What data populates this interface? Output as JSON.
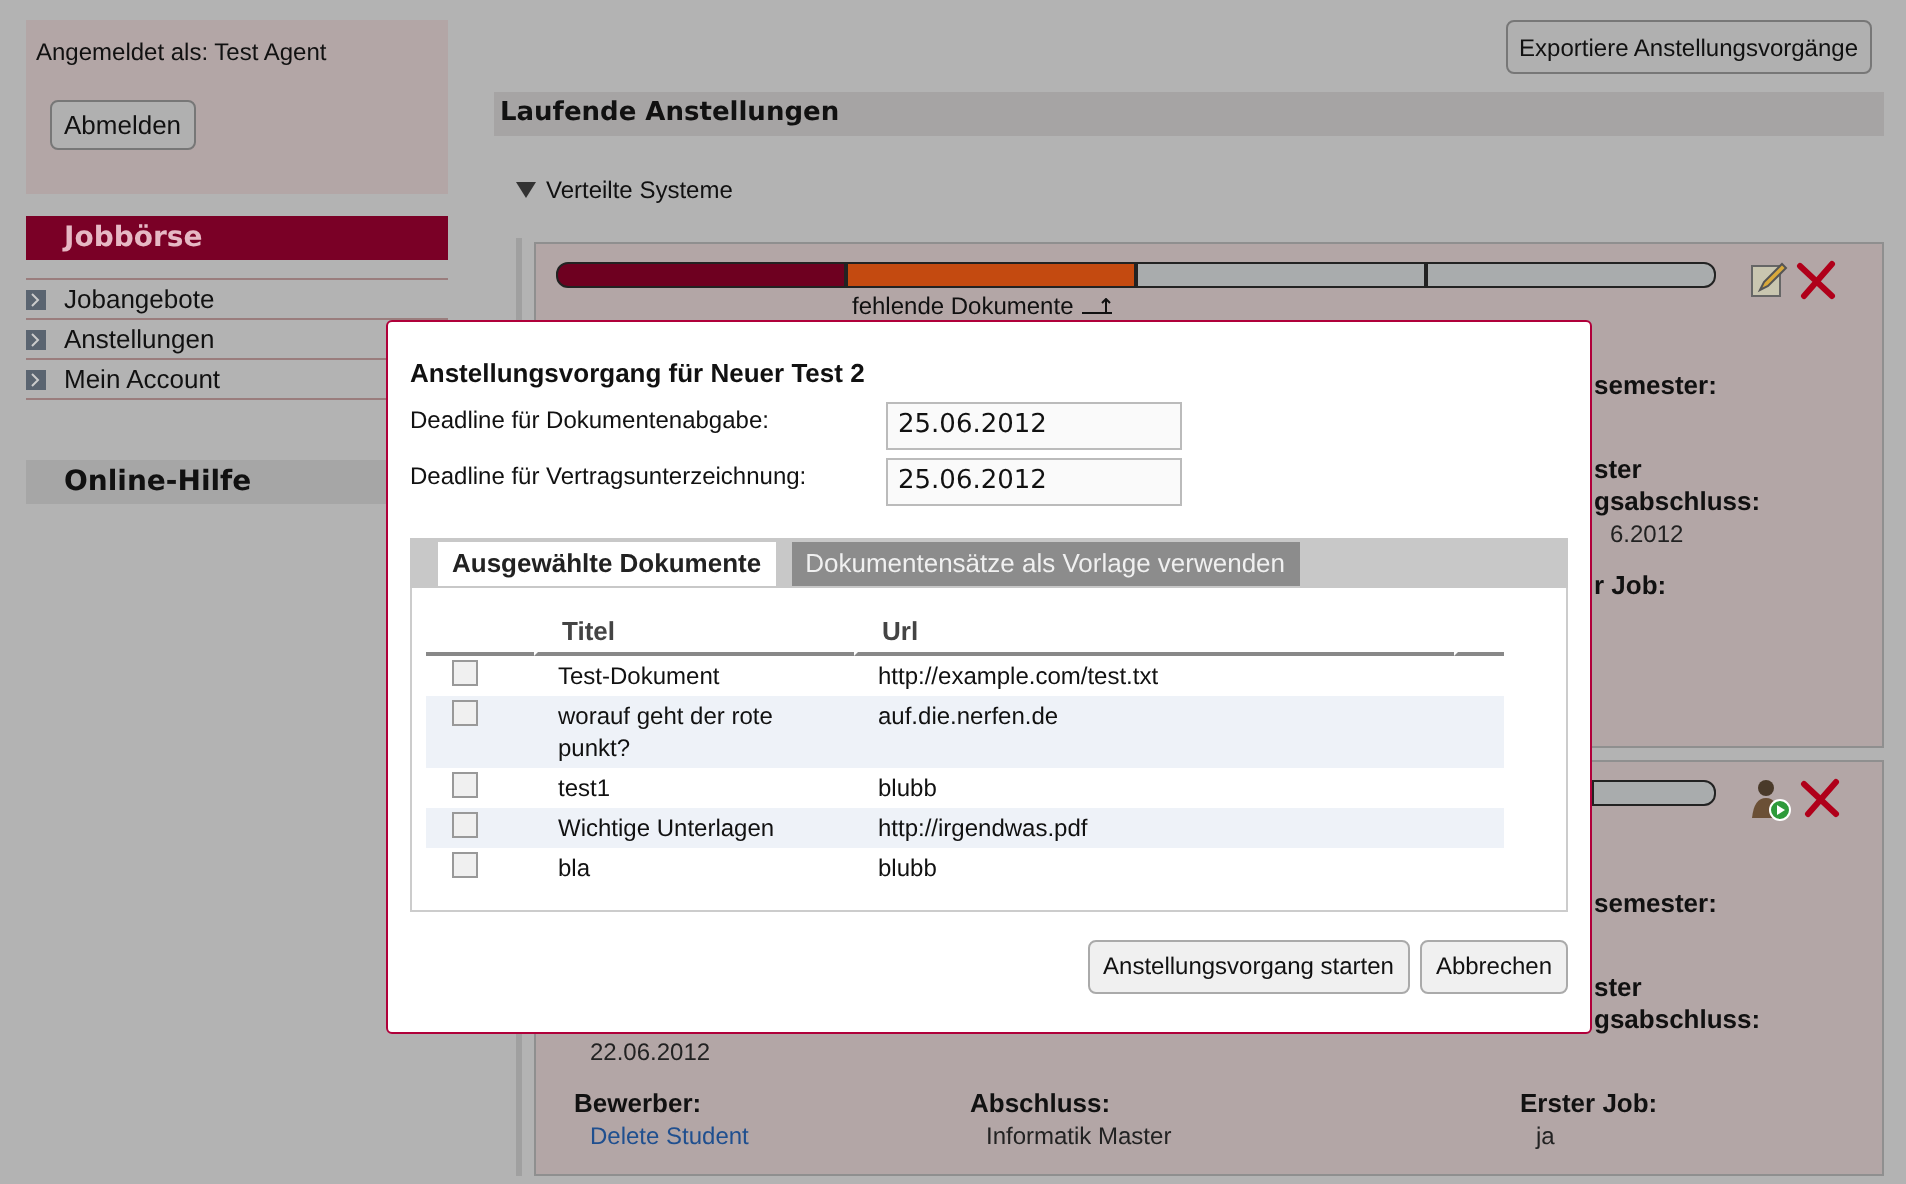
{
  "session": {
    "label": "Angemeldet als: Test Agent",
    "logout_button": "Abmelden"
  },
  "sidebar": {
    "title": "Jobbörse",
    "items": [
      {
        "label": "Jobangebote"
      },
      {
        "label": "Anstellungen"
      },
      {
        "label": "Mein Account"
      }
    ],
    "help_title": "Online-Hilfe"
  },
  "export_button": "Exportiere Anstellungsvorgänge",
  "section_title": "Laufende Anstellungen",
  "group": {
    "title": "Verteilte Systeme",
    "expanded": true
  },
  "cards": [
    {
      "progress": [
        {
          "color": "#6e0020"
        },
        {
          "color": "#c44a10"
        },
        {
          "color": "#a9acad"
        },
        {
          "color": "#a9acad"
        }
      ],
      "status": "fehlende Dokumente",
      "actions": [
        {
          "kind": "edit"
        },
        {
          "kind": "delete"
        }
      ],
      "rows": [
        {
          "right_fragment": {
            "label": [
              "semester:"
            ]
          }
        },
        {
          "right_fragment": {
            "label": [
              "ster",
              "gsabschluss:"
            ],
            "value": "6.2012"
          }
        },
        {
          "right_fragment": {
            "label": [
              "r Job:"
            ]
          }
        }
      ]
    },
    {
      "progress": [
        {
          "color": "#a9acad"
        }
      ],
      "actions": [
        {
          "kind": "start"
        },
        {
          "kind": "delete"
        }
      ],
      "rows": [
        {
          "right_fragment": {
            "label": [
              "semester:"
            ]
          }
        },
        {
          "column_1": {
            "value": "22.06.2012"
          },
          "right_fragment": {
            "label": [
              "ster",
              "gsabschluss:"
            ]
          }
        },
        {
          "column_1": {
            "label": [
              "Bewerber:"
            ],
            "link": "Delete Student"
          },
          "column_2": {
            "label": [
              "Abschluss:"
            ],
            "value": "Informatik Master"
          },
          "column_3": {
            "label": [
              "Erster Job:"
            ],
            "value": "ja"
          }
        }
      ]
    }
  ],
  "dialog": {
    "title": "Anstellungsvorgang für Neuer Test 2",
    "fields": [
      {
        "label": "Deadline für Dokumentenabgabe:",
        "value": "25.06.2012"
      },
      {
        "label": "Deadline für Vertragsunterzeichnung:",
        "value": "25.06.2012"
      }
    ],
    "tabs": [
      {
        "label": "Ausgewählte Dokumente",
        "selected": true
      },
      {
        "label": "Dokumentensätze als Vorlage verwenden",
        "selected": false
      }
    ],
    "columns": [
      "Titel",
      "Url"
    ],
    "rows": [
      {
        "checked": false,
        "title": "Test-Dokument",
        "url": "http://example.com/test.txt"
      },
      {
        "checked": false,
        "title": "worauf geht der rote punkt?",
        "url": "auf.die.nerfen.de"
      },
      {
        "checked": false,
        "title": "test1",
        "url": "blubb"
      },
      {
        "checked": false,
        "title": "Wichtige Unterlagen",
        "url": "http://irgendwas.pdf"
      },
      {
        "checked": false,
        "title": "bla",
        "url": "blubb"
      }
    ],
    "buttons": [
      "Anstellungsvorgang starten",
      "Abbrechen"
    ]
  }
}
